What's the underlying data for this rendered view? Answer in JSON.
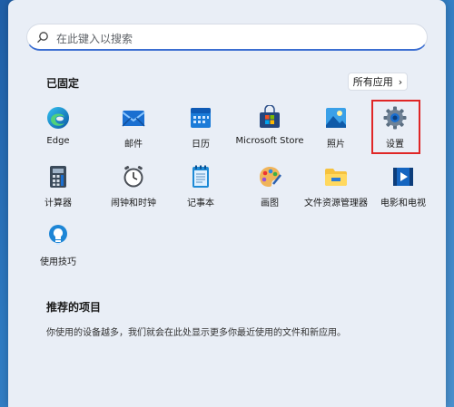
{
  "search": {
    "placeholder": "在此键入以搜索"
  },
  "pinned": {
    "title": "已固定",
    "all_apps_label": "所有应用",
    "apps": [
      {
        "label": "Edge",
        "icon": "edge-icon"
      },
      {
        "label": "邮件",
        "icon": "mail-icon"
      },
      {
        "label": "日历",
        "icon": "calendar-icon"
      },
      {
        "label": "Microsoft Store",
        "icon": "store-icon"
      },
      {
        "label": "照片",
        "icon": "photos-icon"
      },
      {
        "label": "设置",
        "icon": "settings-gear-icon"
      },
      {
        "label": "计算器",
        "icon": "calculator-icon"
      },
      {
        "label": "闹钟和时钟",
        "icon": "alarm-clock-icon"
      },
      {
        "label": "记事本",
        "icon": "notepad-icon"
      },
      {
        "label": "画图",
        "icon": "paint-icon"
      },
      {
        "label": "文件资源管理器",
        "icon": "folder-icon"
      },
      {
        "label": "电影和电视",
        "icon": "movies-tv-icon"
      },
      {
        "label": "使用技巧",
        "icon": "tips-bulb-icon"
      }
    ]
  },
  "recommended": {
    "title": "推荐的项目",
    "description": "你使用的设备越多，我们就会在此处显示更多你最近使用的文件和新应用。"
  },
  "colors": {
    "accent": "#3b6ed1",
    "highlight_box": "#e02626",
    "panel": "#e9eef6"
  }
}
